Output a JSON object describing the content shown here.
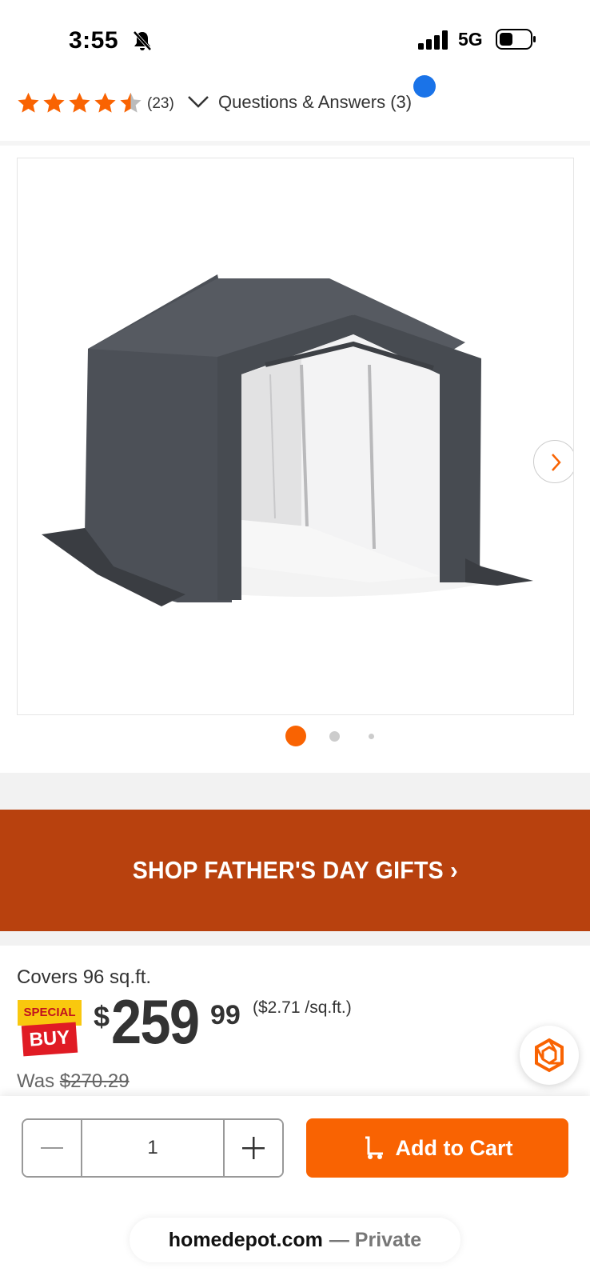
{
  "status_bar": {
    "time": "3:55",
    "network": "5G"
  },
  "rating": {
    "review_count": "(23)",
    "qa_link": "Questions & Answers (3)",
    "stars_value": 4.5,
    "stars_max": 5
  },
  "gallery": {
    "image_alt": "Gray portable shed tent",
    "slide_count": 3,
    "active_slide": 1
  },
  "promo": {
    "text": "SHOP FATHER'S DAY GIFTS ›"
  },
  "price": {
    "covers": "Covers 96 sq.ft.",
    "badge_top": "SPECIAL",
    "badge_bottom": "BUY",
    "dollar_sign": "$",
    "dollars": "259",
    "cents": "99",
    "per_unit": "($2.71 /sq.ft.)",
    "was_label": "Was ",
    "was_price": "$270.29"
  },
  "cart": {
    "quantity": "1",
    "add_label": "Add to Cart"
  },
  "browser": {
    "domain": "homedepot.com",
    "mode": "— Private"
  },
  "colors": {
    "accent": "#f96302",
    "banner": "#b8410e",
    "star": "#f96302"
  }
}
